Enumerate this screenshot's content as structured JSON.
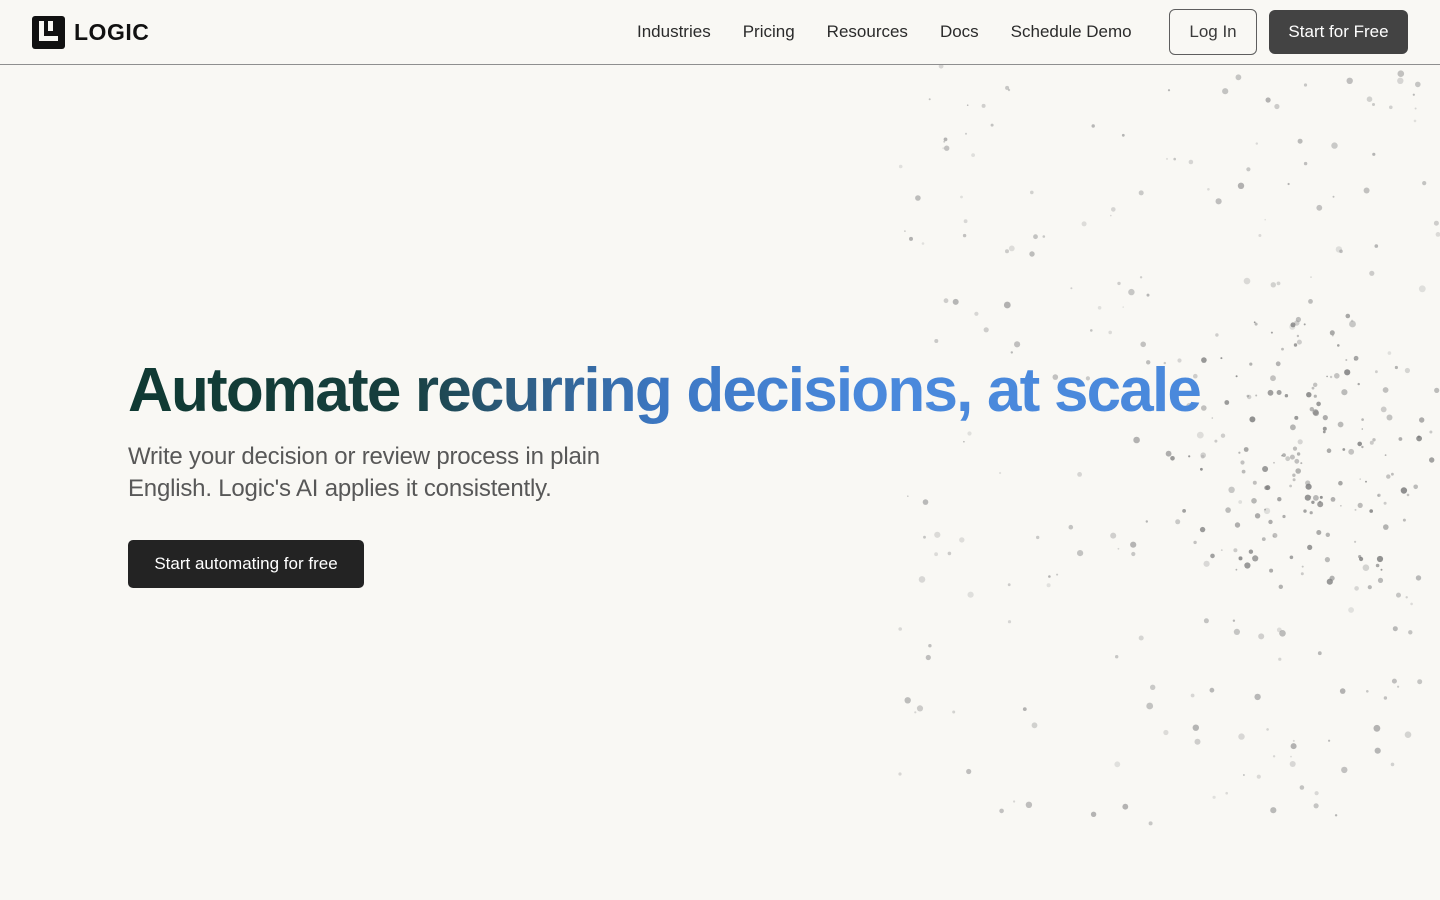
{
  "brand": {
    "name": "LOGIC"
  },
  "nav": {
    "items": [
      {
        "label": "Industries"
      },
      {
        "label": "Pricing"
      },
      {
        "label": "Resources"
      },
      {
        "label": "Docs"
      },
      {
        "label": "Schedule Demo"
      }
    ],
    "login_label": "Log In",
    "start_label": "Start for Free"
  },
  "hero": {
    "headline": "Automate recurring decisions, at scale",
    "subtitle": "Write your decision or review process in plain English. Logic's AI applies it consistently.",
    "cta_label": "Start automating for free"
  },
  "colors": {
    "background": "#f9f8f4",
    "headline_dark": "#0f3a33",
    "headline_blue": "#4a89dc",
    "button_dark": "#232323",
    "dot": "#9a9a9a"
  },
  "icons": {
    "logo": "logic-logo-icon"
  }
}
